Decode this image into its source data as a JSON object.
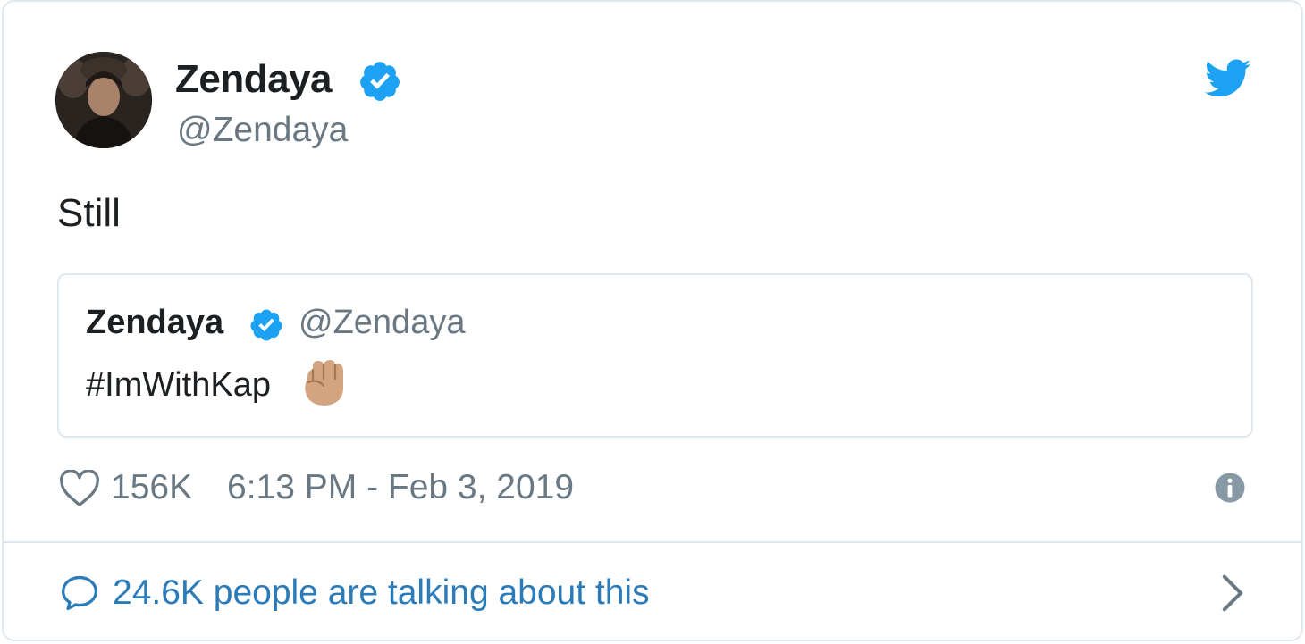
{
  "tweet": {
    "author": {
      "name": "Zendaya",
      "handle": "@Zendaya",
      "verified": true
    },
    "text": "Still",
    "quoted": {
      "author": {
        "name": "Zendaya",
        "handle": "@Zendaya",
        "verified": true
      },
      "text": "#ImWithKap",
      "emoji": "raised-fist-medium-skin-tone"
    },
    "likes": "156K",
    "timestamp": "6:13 PM - Feb 3, 2019",
    "talking": "24.6K people are talking about this"
  },
  "icons": {
    "brand": "twitter-bird-icon",
    "verified": "verified-badge-icon",
    "like": "heart-icon",
    "info": "info-icon",
    "reply": "speech-bubble-icon",
    "more": "chevron-right-icon"
  },
  "colors": {
    "twitter_blue": "#1da1f2",
    "link_blue": "#2b7bb9",
    "muted_text": "#697882",
    "border": "#e1e8ed",
    "text": "#1c2022"
  }
}
